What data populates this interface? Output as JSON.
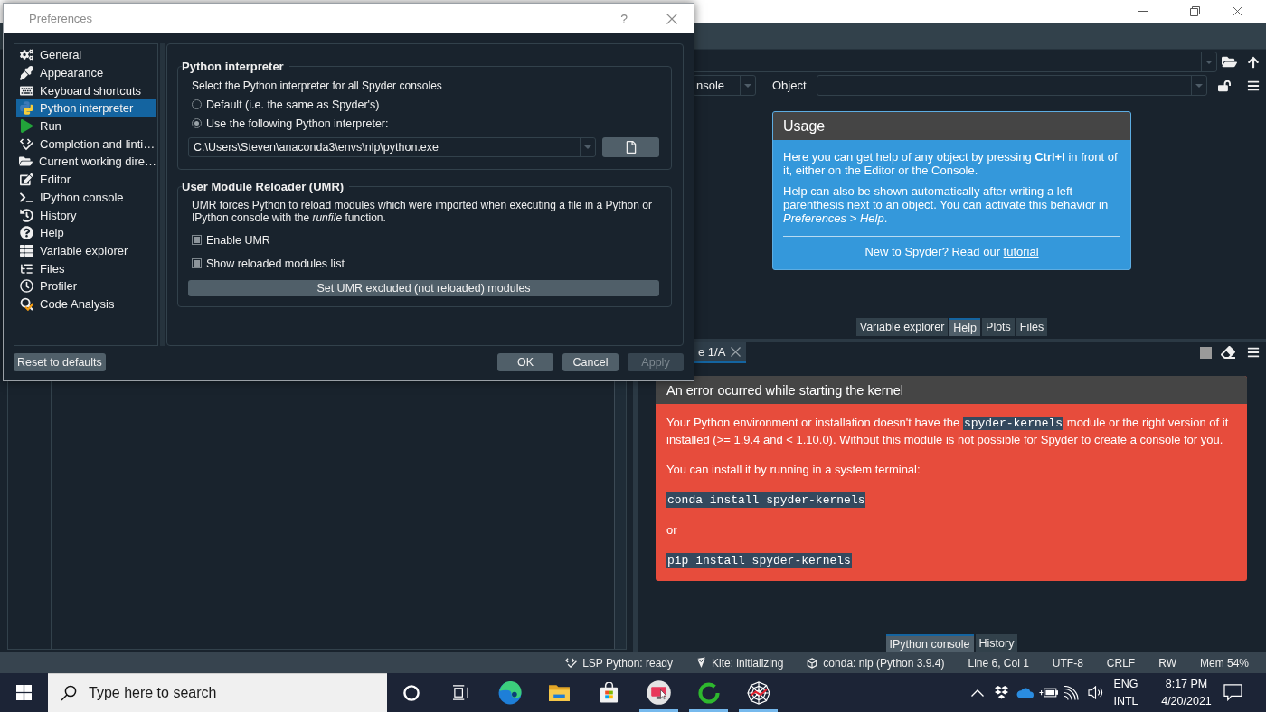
{
  "dialog": {
    "title": "Preferences",
    "help": "?",
    "sidebar": [
      {
        "label": "General",
        "selected": false
      },
      {
        "label": "Appearance",
        "selected": false
      },
      {
        "label": "Keyboard shortcuts",
        "selected": false
      },
      {
        "label": "Python interpreter",
        "selected": true
      },
      {
        "label": "Run",
        "selected": false
      },
      {
        "label": "Completion and linti…",
        "selected": false
      },
      {
        "label": "Current working dire…",
        "selected": false
      },
      {
        "label": "Editor",
        "selected": false
      },
      {
        "label": "IPython console",
        "selected": false
      },
      {
        "label": "History",
        "selected": false
      },
      {
        "label": "Help",
        "selected": false
      },
      {
        "label": "Variable explorer",
        "selected": false
      },
      {
        "label": "Files",
        "selected": false
      },
      {
        "label": "Profiler",
        "selected": false
      },
      {
        "label": "Code Analysis",
        "selected": false
      }
    ],
    "interpreter": {
      "title": "Python interpreter",
      "description": "Select the Python interpreter for all Spyder consoles",
      "options": [
        {
          "label": "Default (i.e. the same as Spyder's)",
          "selected": false
        },
        {
          "label": "Use the following Python interpreter:",
          "selected": true
        }
      ],
      "path": "C:\\Users\\Steven\\anaconda3\\envs\\nlp\\python.exe"
    },
    "umr": {
      "title": "User Module Reloader (UMR)",
      "description": "UMR forces Python to reload modules which were imported when executing a file in a Python or IPython console with the *runfile* function.",
      "options": [
        {
          "label": "Enable UMR",
          "checked": true
        },
        {
          "label": "Show reloaded modules list",
          "checked": true
        }
      ],
      "button": "Set UMR excluded (not reloaded) modules"
    },
    "reset_button": "Reset to defaults",
    "buttons": [
      {
        "label": "OK",
        "disabled": false
      },
      {
        "label": "Cancel",
        "disabled": false
      },
      {
        "label": "Apply",
        "disabled": true
      }
    ]
  },
  "main_window": {
    "help_pane": {
      "source": "nsole",
      "object_label": "Object",
      "usage": {
        "title": "Usage",
        "paragraphs": [
          "Here you can get help of any object by pressing **Ctrl+I** in front of it, either on the Editor or the Console.",
          "Help can also be shown automatically after writing a left parenthesis next to an object. You can activate this behavior in *Preferences > Help*."
        ],
        "footer": "New to Spyder? Read our",
        "footer_link": "tutorial"
      },
      "tabs": [
        {
          "label": "Variable explorer",
          "selected": false
        },
        {
          "label": "Help",
          "selected": true
        },
        {
          "label": "Plots",
          "selected": false
        },
        {
          "label": "Files",
          "selected": false
        }
      ]
    },
    "console_pane": {
      "tabs": [
        {
          "label": "e 1/A",
          "selected": true
        }
      ],
      "error": {
        "title": "An error ocurred while starting the kernel",
        "blocks": [
          {
            "kind": "text",
            "parts": [
              {
                "text": "Your Python environment or installation doesn't have the",
                "code": false
              },
              {
                "text": "spyder-kernels",
                "code": true
              },
              {
                "text": "module or the right version of it installed (>= 1.9.4 and < 1.10.0). Without this module is not possible for Spyder to create a console for you.",
                "code": false
              }
            ]
          },
          {
            "kind": "text",
            "parts": [
              {
                "text": "You can install it by running in a system terminal:",
                "code": false
              }
            ]
          },
          {
            "kind": "code",
            "text": "conda install spyder-kernels"
          },
          {
            "kind": "text",
            "parts": [
              {
                "text": "or",
                "code": false
              }
            ]
          },
          {
            "kind": "code",
            "text": "pip install spyder-kernels"
          }
        ]
      },
      "pane_tabs": [
        {
          "label": "IPython console",
          "selected": true
        },
        {
          "label": "History",
          "selected": false
        }
      ]
    },
    "status_bar": [
      "LSP Python: ready",
      "Kite: initializing",
      "conda: nlp (Python 3.9.4)",
      "Line 6, Col 1",
      "UTF-8",
      "CRLF",
      "RW",
      "Mem 54%"
    ]
  },
  "taskbar": {
    "search_placeholder": "Type here to search",
    "apps": [
      {
        "running": false
      },
      {
        "running": false
      },
      {
        "running": false
      },
      {
        "running": true
      },
      {
        "running": true
      },
      {
        "running": true
      }
    ],
    "language": "ENG",
    "layout": "INTL",
    "time": "8:17 PM",
    "date": "4/20/2021"
  }
}
